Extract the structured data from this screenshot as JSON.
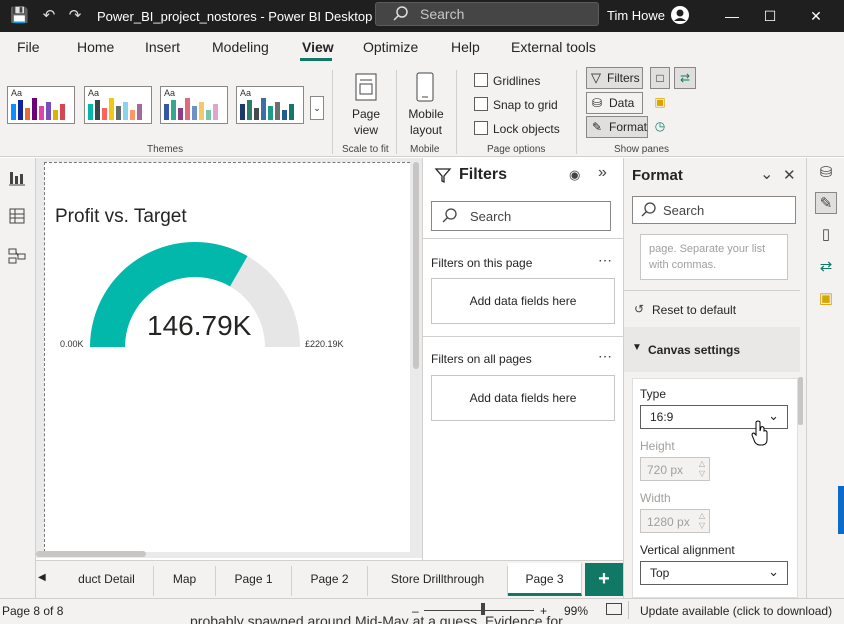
{
  "titlebar": {
    "app_title": "Power_BI_project_nostores - Power BI Desktop",
    "search_placeholder": "Search",
    "user_name": "Tim Howe"
  },
  "menu": [
    "File",
    "Home",
    "Insert",
    "Modeling",
    "View",
    "Optimize",
    "Help",
    "External tools"
  ],
  "ribbon": {
    "themes_label": "Themes",
    "theme_text": "Aa",
    "page_view_label": "Page view",
    "mobile_layout_label": "Mobile layout",
    "scale_to_fit_label": "Scale to fit",
    "mobile_label": "Mobile",
    "gridlines_label": "Gridlines",
    "snap_to_grid_label": "Snap to grid",
    "lock_objects_label": "Lock objects",
    "page_options_label": "Page options",
    "filters_btn": "Filters",
    "data_btn": "Data",
    "format_btn": "Format",
    "show_panes_label": "Show panes"
  },
  "visual": {
    "title": "Profit vs. Target",
    "value": "146.79K",
    "min": "0.00K",
    "max": "£220.19K",
    "fill_fraction": 0.6667,
    "gauge_color": "#01b8aa"
  },
  "filters": {
    "title": "Filters",
    "search_placeholder": "Search",
    "on_this_page": "Filters on this page",
    "on_all_pages": "Filters on all pages",
    "add_fields": "Add data fields here"
  },
  "format": {
    "title": "Format",
    "search_placeholder": "Search",
    "textarea_text": "page. Separate your list with commas.",
    "reset_label": "Reset to default",
    "canvas_settings": "Canvas settings",
    "type_label": "Type",
    "type_value": "16:9",
    "height_label": "Height",
    "height_value": "720 px",
    "width_label": "Width",
    "width_value": "1280 px",
    "vertical_alignment_label": "Vertical alignment",
    "vertical_alignment_value": "Top"
  },
  "tabs": [
    "duct Detail",
    "Map",
    "Page 1",
    "Page 2",
    "Store Drillthrough",
    "Page 3"
  ],
  "active_tab": "Page 3",
  "status": {
    "page_info": "Page 8 of 8",
    "zoom": "99%",
    "update": "Update available (click to download)"
  },
  "background_text": "probably spawned around Mid-May at a guess. Evidence for"
}
